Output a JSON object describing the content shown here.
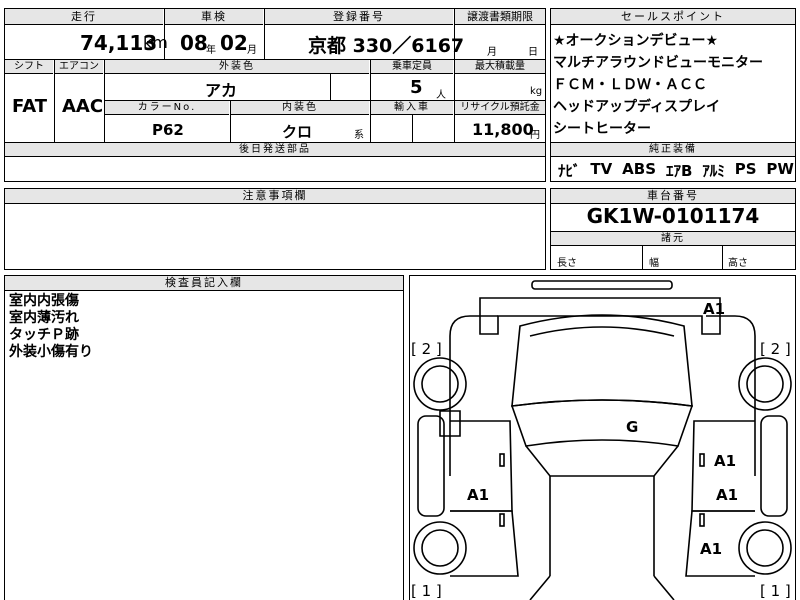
{
  "vehicle": {
    "header": {
      "mileage": "走行",
      "inspection": "車検",
      "registration": "登録番号",
      "transfer_deadline": "譲渡書類期限"
    },
    "mileage_value": "74,113",
    "mileage_unit": "km",
    "inspection_year": "08",
    "inspection_year_unit": "年",
    "inspection_month": "02",
    "inspection_month_unit": "月",
    "plate": "京都 330／6167",
    "deadline_month_unit": "月",
    "deadline_day_unit": "日",
    "labels": {
      "shift": "シフト",
      "aircon": "エアコン",
      "exterior_color": "外装色",
      "capacity": "乗車定員",
      "max_load": "最大積載量",
      "color_no": "カラーNo.",
      "interior_color": "内装色",
      "import": "輸入車",
      "recycle": "リサイクル預託金"
    },
    "shift": "FAT",
    "aircon": "AAC",
    "exterior_color": "アカ",
    "capacity": "5",
    "capacity_unit": "人",
    "load_unit": "kg",
    "color_no": "P62",
    "interior_color": "クロ",
    "interior_unit": "系",
    "recycle": "11,800",
    "recycle_unit": "円",
    "later_parts_label": "後日発送部品"
  },
  "sales_points": {
    "title": "セールスポイント",
    "items": [
      "★オークションデビュー★",
      "マルチアラウンドビューモニター",
      "ＦＣＭ・ＬＤＷ・ＡＣＣ",
      "ヘッドアップディスプレイ",
      "シートヒーター"
    ],
    "equipment_title": "純正装備",
    "equipment": [
      "ﾅﾋﾞ",
      "TV",
      "ABS",
      "ｴｱB",
      "ｱﾙﾐ",
      "PS",
      "PW"
    ]
  },
  "notes": {
    "title": "注意事項欄"
  },
  "chassis": {
    "title": "車台番号",
    "number": "GK1W-0101174",
    "dims_title": "諸元",
    "length": "長さ",
    "width": "幅",
    "height": "高さ"
  },
  "inspector": {
    "title": "検査員記入欄",
    "lines": [
      "室内内張傷",
      "室内薄汚れ",
      "タッチＰ跡",
      "外装小傷有り"
    ]
  },
  "diagram": {
    "marks": [
      "A1",
      "[ 2 ]",
      "[ 2 ]",
      "G",
      "A1",
      "A1",
      "A1",
      "A1",
      "[ 1 ]",
      "[ 1 ]"
    ]
  }
}
